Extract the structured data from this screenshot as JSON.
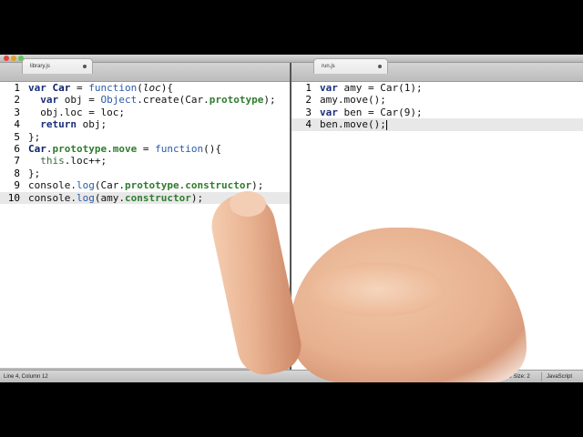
{
  "window": {
    "title": ""
  },
  "tabs": {
    "left": {
      "label": "library.js"
    },
    "right": {
      "label": "run.js"
    }
  },
  "left_pane": {
    "lines": [
      {
        "n": "1"
      },
      {
        "n": "2"
      },
      {
        "n": "3"
      },
      {
        "n": "4"
      },
      {
        "n": "5"
      },
      {
        "n": "6"
      },
      {
        "n": "7"
      },
      {
        "n": "8"
      },
      {
        "n": "9"
      },
      {
        "n": "10"
      }
    ],
    "code": {
      "l1": [
        "var ",
        "Car",
        " = ",
        "function",
        "(",
        "loc",
        "){"
      ],
      "l2": [
        "  var ",
        "obj = ",
        "Object",
        ".create(Car.",
        "prototype",
        ");"
      ],
      "l3": [
        "  obj.loc = loc;"
      ],
      "l4": [
        "  return ",
        "obj;"
      ],
      "l5": [
        "};"
      ],
      "l6": [
        "Car",
        ".",
        "prototype",
        ".",
        "move",
        " = ",
        "function",
        "(){"
      ],
      "l7": [
        "  ",
        "this",
        ".loc++;"
      ],
      "l8": [
        "};"
      ],
      "l9": [
        "console.",
        "log",
        "(Car.",
        "prototype",
        ".",
        "constructor",
        ");"
      ],
      "l10": [
        "console.",
        "log",
        "(amy.",
        "constructor",
        ");"
      ]
    }
  },
  "right_pane": {
    "lines": [
      {
        "n": "1"
      },
      {
        "n": "2"
      },
      {
        "n": "3"
      },
      {
        "n": "4"
      }
    ],
    "code": {
      "l1": [
        "var ",
        "amy = Car(1);"
      ],
      "l2": [
        "amy.move();"
      ],
      "l3": [
        "var ",
        "ben = Car(9);"
      ],
      "l4": [
        "ben.move();"
      ]
    }
  },
  "status": {
    "position": "Line 4, Column 12",
    "tab_size": "Tab Size: 2",
    "language": "JavaScript"
  },
  "colors": {
    "keyword": "#1a2f7a",
    "property": "#2e7d2e",
    "function": "#2a5aa8"
  }
}
